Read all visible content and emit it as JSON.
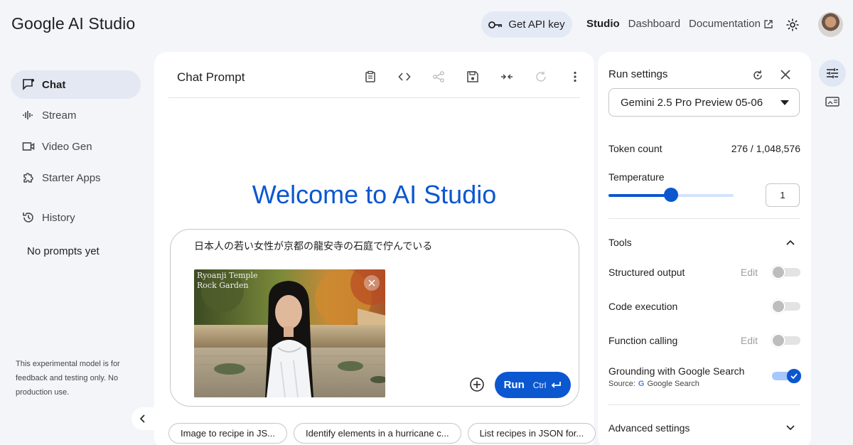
{
  "header": {
    "brand": "Google AI Studio",
    "api_key_label": "Get API key",
    "nav": [
      "Studio",
      "Dashboard",
      "Documentation"
    ],
    "active_nav": "Studio"
  },
  "sidebar": {
    "items": [
      {
        "label": "Chat",
        "icon": "chat-icon",
        "active": true
      },
      {
        "label": "Stream",
        "icon": "stream-icon"
      },
      {
        "label": "Video Gen",
        "icon": "video-icon"
      },
      {
        "label": "Starter Apps",
        "icon": "puzzle-icon"
      },
      {
        "label": "History",
        "icon": "history-icon"
      }
    ],
    "empty_history": "No prompts yet",
    "disclaimer": "This experimental model is for feedback and testing only. No production use."
  },
  "main": {
    "title": "Chat Prompt",
    "toolbar_icons": [
      "clipboard-icon",
      "code-icon",
      "share-icon",
      "save-icon",
      "compare-icon",
      "refresh-icon",
      "more-icon"
    ],
    "welcome": "Welcome to AI Studio",
    "prompt_text": "日本人の若い女性が京都の龍安寺の石庭で佇んでいる",
    "image_caption": "Ryoanji Temple\nRock Garden",
    "run_label": "Run",
    "run_shortcut": "Ctrl",
    "chips": [
      "Image to recipe in JS...",
      "Identify elements in a hurricane c...",
      "List recipes in JSON for..."
    ]
  },
  "settings": {
    "title": "Run settings",
    "model": "Gemini 2.5 Pro Preview 05-06",
    "token_label": "Token count",
    "token_value": "276 / 1,048,576",
    "temperature_label": "Temperature",
    "temperature_value": "1",
    "temperature_fraction": 0.5,
    "tools_label": "Tools",
    "tools": [
      {
        "label": "Structured output",
        "edit": "Edit",
        "enabled": false
      },
      {
        "label": "Code execution",
        "edit": "",
        "enabled": false
      },
      {
        "label": "Function calling",
        "edit": "Edit",
        "enabled": false
      },
      {
        "label": "Grounding with Google Search",
        "edit": "",
        "enabled": true
      }
    ],
    "source_label": "Source:",
    "source_value": "Google Search",
    "advanced_label": "Advanced settings"
  },
  "colors": {
    "accent": "#0b57d0",
    "background": "#f3f5f9",
    "panel": "#ffffff"
  }
}
